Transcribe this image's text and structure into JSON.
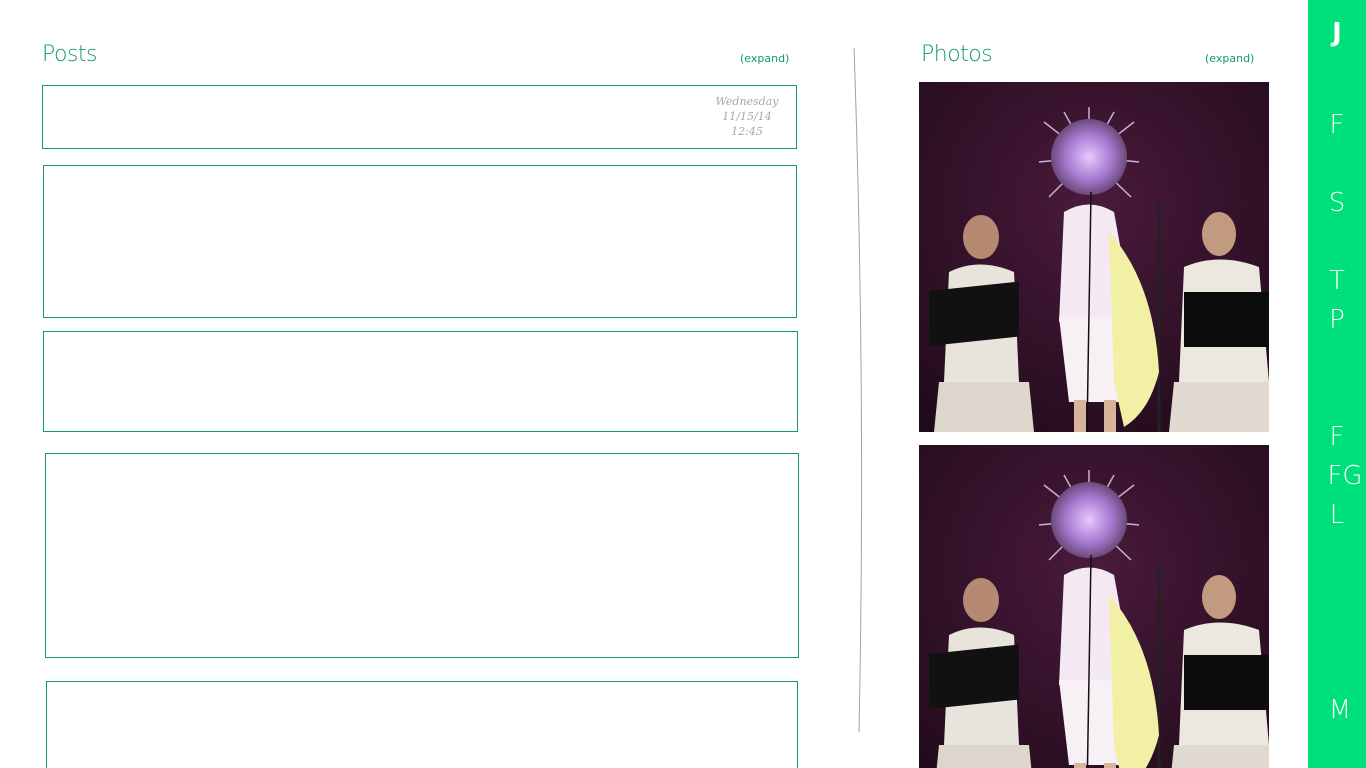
{
  "posts": {
    "title": "Posts",
    "expand_label": "(expand)",
    "items": [
      {
        "day": "Wednesday",
        "date": "11/15/14",
        "time": "12:45"
      },
      {},
      {},
      {},
      {}
    ]
  },
  "photos": {
    "title": "Photos",
    "expand_label": "(expand)",
    "items": [
      {
        "subject": "performer-on-stage-with-spiked-headdress"
      },
      {
        "subject": "performer-on-stage-with-spiked-headdress"
      }
    ]
  },
  "rail": {
    "color": "#00e07a",
    "letters": [
      "J",
      "F",
      "S",
      "T",
      "P",
      "F",
      "FG",
      "L",
      "M"
    ]
  },
  "colors": {
    "accent": "#14996a",
    "rail": "#00e07a",
    "date_text": "#a8a8a8"
  }
}
